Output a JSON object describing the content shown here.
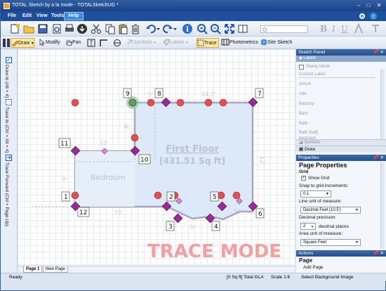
{
  "window": {
    "title": "TOTAL Sketch by a la mode - TOTALSketchUG *"
  },
  "menu": {
    "items": [
      "File",
      "Edit",
      "View",
      "Tools"
    ],
    "help": "Help"
  },
  "toolbar2": {
    "draw": "Draw",
    "modify": "Modify",
    "pan": "Pan",
    "symbols": "Symbols",
    "labels": "Labels",
    "trace": "Trace",
    "photometrics": "Photometrics",
    "site_sketch": "Site Sketch"
  },
  "left_toolbar": {
    "draw_to": "Draw to (Alt + 4)",
    "trace_to": "Trace to (Ctrl + Alt + 4)",
    "trace_forward": "Trace Forward (Ctrl + Page Up)"
  },
  "canvas": {
    "room_title": "First Floor",
    "room_area": "[431.51 Sq ft]",
    "room2_label": "Bedroom",
    "watermark": "TRACE MODE",
    "vertex_labels": [
      "1",
      "2",
      "3",
      "4",
      "5",
      "6",
      "7",
      "8",
      "9",
      "10",
      "11",
      "12"
    ],
    "dims": {
      "top_left": "5'",
      "top_right": "14.2'",
      "upper_left": "10'",
      "bottom_left": "15'",
      "bottom_mid": "5'",
      "bottom_right": "5'",
      "bottom_far": "5'",
      "left_side": "9'",
      "right_side": "12'",
      "inner": "8'"
    }
  },
  "page_tabs": [
    "Page 1",
    "New Page"
  ],
  "status": {
    "ready": "Ready",
    "gla": "[0 Sq ft] Total GLA",
    "scale": "Scale 1:6"
  },
  "sketch_panel": {
    "title": "Sketch Panel",
    "labels_tab": "Labels",
    "stamp_mode": "Stamp Mode",
    "custom_label": "Custom Label",
    "items": [
      "Atrium",
      "Attic",
      "Balcony",
      "Barn",
      "Bath",
      "Bath (half)",
      "Bedroom"
    ],
    "symbols_tab": "Symbols",
    "draw_tab": "Draw"
  },
  "properties": {
    "title": "Properties",
    "heading": "Page Properties",
    "grid": "Grid",
    "show_grid": "Show Grid",
    "snap_label": "Snap to grid increments:",
    "snap_value": "0.1",
    "line_unit_label": "Line unit of measure:",
    "line_unit_value": "Decimal Feet (10.5')",
    "decimal_label": "Decimal precision:",
    "decimal_value": "2",
    "decimal_places": "decimal places",
    "area_unit_label": "Area unit of measure:",
    "area_unit_value": "Square Feet"
  },
  "actions": {
    "title": "Actions",
    "heading": "Page",
    "add_page": "Add Page",
    "select_background": "Select Background Image"
  },
  "colors": {
    "accent": "#1d4f9c",
    "vertex": "#9a2a9a",
    "point": "#e05050",
    "watermark": "#f0a0a0"
  }
}
